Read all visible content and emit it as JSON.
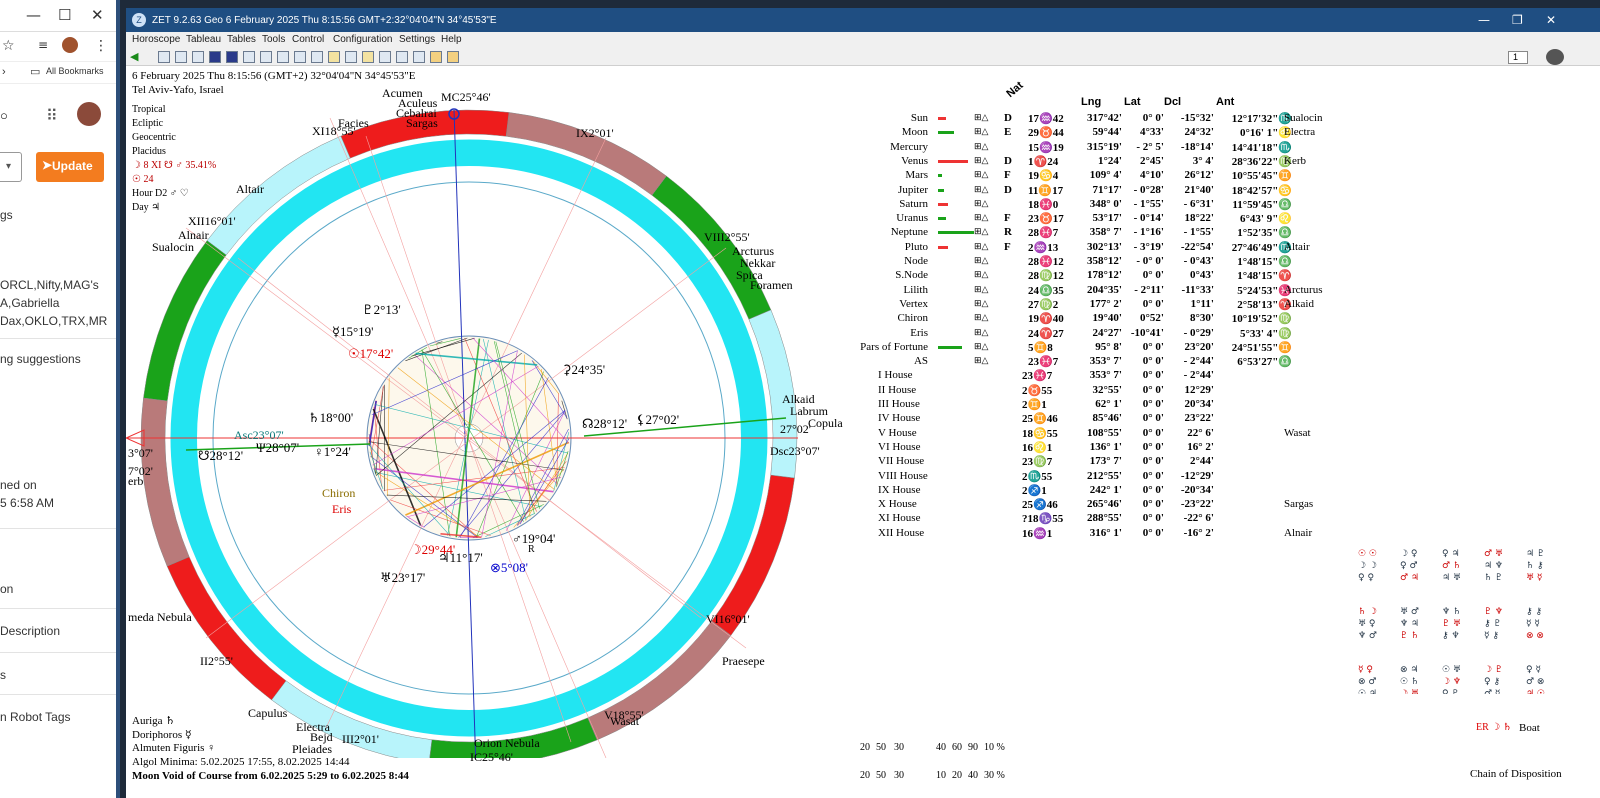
{
  "browser": {
    "bookmarks_label": "All Bookmarks",
    "update_label": "Update",
    "sidebar_texts": [
      "gs",
      "ORCL,Nifty,MAG's",
      "A,Gabriella",
      "Dax,OKLO,TRX,MR",
      "ng suggestions",
      "ned on",
      "5 6:58 AM",
      "on",
      "Description",
      "s",
      "n Robot Tags"
    ]
  },
  "app": {
    "title": "ZET 9.2.63 Geo    6 February 2025  Thu    8:15:56 GMT+2:32°04'04\"N  34°45'53\"E",
    "menu": [
      "Horoscope",
      "Tableau",
      "Tables",
      "Tools",
      "Control",
      "Configuration",
      "Settings",
      "Help"
    ],
    "page_number": "1"
  },
  "chart_header": {
    "line1": "6 February 2025  Thu   8:15:56 (GMT+2) 32°04'04\"N  34°45'53\"E",
    "line2": "Tel Aviv-Yafo, Israel",
    "info": [
      "Tropical",
      "Ecliptic",
      "Geocentric",
      "Placidus",
      "☽  8 XI ☋ ♂ 35.41%",
      "☉  24",
      "Hour D2 ♂ ♡",
      "Day ♃"
    ]
  },
  "wheel_labels": {
    "mc": "MC25°46'",
    "ic": "IC25°46'",
    "asc": "Asc23°07'",
    "dsc": "Dsc23°07'",
    "cusp_ix": "IX2°01'",
    "cusp_viii": "VIII2°55'",
    "cusp_xi": "XI18°55'",
    "cusp_xii": "XII16°01'",
    "cusp_vi": "VI16°01'",
    "cusp_v": "V18°55'",
    "cusp_ii": "II2°55'",
    "cusp_iii": "III2°01'",
    "planets": [
      {
        "t": "♇2°13'",
        "c": "#000"
      },
      {
        "t": "☿15°19'",
        "c": "#000"
      },
      {
        "t": "☉17°42'",
        "c": "#d00"
      },
      {
        "t": "♄18°00'",
        "c": "#000"
      },
      {
        "t": "♅23°17'",
        "c": "#000"
      },
      {
        "t": "♃11°17'",
        "c": "#000"
      },
      {
        "t": "☽29°44'",
        "c": "#d00"
      },
      {
        "t": "♂19°04'",
        "c": "#000"
      },
      {
        "t": "⊗5°08'",
        "c": "#00c"
      },
      {
        "t": "☊28°12'",
        "c": "#000"
      },
      {
        "t": "⚸27°02'",
        "c": "#000"
      },
      {
        "t": "⚳24°35'",
        "c": "#000"
      },
      {
        "t": "Ψ28°07'",
        "c": "#000"
      },
      {
        "t": "♀1°24'",
        "c": "#000"
      },
      {
        "t": "☋28°12'",
        "c": "#000"
      },
      {
        "t": "Chiron",
        "c": "#8a6d00"
      },
      {
        "t": "Eris",
        "c": "#d00"
      },
      {
        "t": "R",
        "c": "#000"
      }
    ],
    "stars": [
      "Acumen",
      "Aculeus",
      "Cebalrai",
      "Sargas",
      "Facies",
      "Altair",
      "Alnair",
      "Sualocin",
      "Arcturus",
      "Nekkar",
      "Spica",
      "Foramen",
      "Alkaid",
      "Labrum",
      "Copula",
      "Praesepe",
      "Wasat",
      "Capulus",
      "Electra",
      "Bejd",
      "Pleiades",
      "Orion Nebula",
      "meda Nebula",
      "erb",
      "3°07'",
      "7°02'",
      "27°02'"
    ]
  },
  "footer": {
    "lines": [
      "Auriga  ♄",
      "Doriphoros  ☿",
      "Almuten Figuris  ♀",
      "Algol Minima: 5.02.2025 17:55,  8.02.2025 14:44",
      "Moon Void of Course from 6.02.2025  5:29 to 6.02.2025  8:44"
    ]
  },
  "table": {
    "headers": {
      "nat": "Nat",
      "lng": "Lng",
      "lat": "Lat",
      "dcl": "Dcl",
      "ant": "Ant"
    },
    "planets": [
      {
        "name": "Sun",
        "state": "D",
        "pos": "17♒42",
        "lng": "317°42'",
        "lat": "0° 0'",
        "dcl": "-15°32'",
        "ant": "12°17'32\"♏",
        "star": "Sualocin"
      },
      {
        "name": "Moon",
        "state": "E",
        "pos": "29♉44",
        "lng": "59°44'",
        "lat": "4°33'",
        "dcl": "24°32'",
        "ant": "0°16' 1\"♌",
        "star": "Electra"
      },
      {
        "name": "Mercury",
        "state": "",
        "pos": "15♒19",
        "lng": "315°19'",
        "lat": "- 2° 5'",
        "dcl": "-18°14'",
        "ant": "14°41'18\"♏",
        "star": ""
      },
      {
        "name": "Venus",
        "state": "D",
        "pos": "1♈24",
        "lng": "1°24'",
        "lat": "2°45'",
        "dcl": "3° 4'",
        "ant": "28°36'22\"♍",
        "star": "Kerb"
      },
      {
        "name": "Mars",
        "state": "F",
        "pos": "19♋4",
        "lng": "109° 4'",
        "lat": "4°10'",
        "dcl": "26°12'",
        "ant": "10°55'45\"♊",
        "star": ""
      },
      {
        "name": "Jupiter",
        "state": "D",
        "pos": "11♊17",
        "lng": "71°17'",
        "lat": "- 0°28'",
        "dcl": "21°40'",
        "ant": "18°42'57\"♋",
        "star": ""
      },
      {
        "name": "Saturn",
        "state": "",
        "pos": "18♓0",
        "lng": "348° 0'",
        "lat": "- 1°55'",
        "dcl": "- 6°31'",
        "ant": "11°59'45\"♎",
        "star": ""
      },
      {
        "name": "Uranus",
        "state": "F",
        "pos": "23♉17",
        "lng": "53°17'",
        "lat": "- 0°14'",
        "dcl": "18°22'",
        "ant": "6°43' 9\"♌",
        "star": ""
      },
      {
        "name": "Neptune",
        "state": "R",
        "pos": "28♓7",
        "lng": "358° 7'",
        "lat": "- 1°16'",
        "dcl": "- 1°55'",
        "ant": "1°52'35\"♎",
        "star": ""
      },
      {
        "name": "Pluto",
        "state": "F",
        "pos": "2♒13",
        "lng": "302°13'",
        "lat": "- 3°19'",
        "dcl": "-22°54'",
        "ant": "27°46'49\"♏",
        "star": "Altair"
      },
      {
        "name": "Node",
        "state": "",
        "pos": "28♓12",
        "lng": "358°12'",
        "lat": "- 0° 0'",
        "dcl": "- 0°43'",
        "ant": "1°48'15\"♎",
        "star": ""
      },
      {
        "name": "S.Node",
        "state": "",
        "pos": "28♍12",
        "lng": "178°12'",
        "lat": "0° 0'",
        "dcl": "0°43'",
        "ant": "1°48'15\"♈",
        "star": ""
      },
      {
        "name": "Lilith",
        "state": "",
        "pos": "24♎35",
        "lng": "204°35'",
        "lat": "- 2°11'",
        "dcl": "-11°33'",
        "ant": "5°24'53\"♓",
        "star": "Arcturus"
      },
      {
        "name": "Vertex",
        "state": "",
        "pos": "27♍2",
        "lng": "177° 2'",
        "lat": "0° 0'",
        "dcl": "1°11'",
        "ant": "2°58'13\"♈",
        "star": "Alkaid"
      },
      {
        "name": "Chiron",
        "state": "",
        "pos": "19♈40",
        "lng": "19°40'",
        "lat": "0°52'",
        "dcl": "8°30'",
        "ant": "10°19'52\"♍",
        "star": ""
      },
      {
        "name": "Eris",
        "state": "",
        "pos": "24♈27",
        "lng": "24°27'",
        "lat": "-10°41'",
        "dcl": "- 0°29'",
        "ant": "5°33' 4\"♍",
        "star": ""
      },
      {
        "name": "Pars of Fortune",
        "state": "",
        "pos": "5♊8",
        "lng": "95° 8'",
        "lat": "0° 0'",
        "dcl": "23°20'",
        "ant": "24°51'55\"♊",
        "star": ""
      },
      {
        "name": "AS",
        "state": "",
        "pos": "23♓7",
        "lng": "353° 7'",
        "lat": "0° 0'",
        "dcl": "- 2°44'",
        "ant": "6°53'27\"♎",
        "star": ""
      }
    ],
    "houses": [
      {
        "name": "I House",
        "pos": "23♓7",
        "lng": "353° 7'",
        "lat": "0° 0'",
        "dcl": "- 2°44'",
        "star": ""
      },
      {
        "name": "II House",
        "pos": "2♉55",
        "lng": "32°55'",
        "lat": "0° 0'",
        "dcl": "12°29'",
        "star": ""
      },
      {
        "name": "III House",
        "pos": "2♊1",
        "lng": "62° 1'",
        "lat": "0° 0'",
        "dcl": "20°34'",
        "star": ""
      },
      {
        "name": "IV House",
        "pos": "25♊46",
        "lng": "85°46'",
        "lat": "0° 0'",
        "dcl": "23°22'",
        "star": ""
      },
      {
        "name": "V House",
        "pos": "18♋55",
        "lng": "108°55'",
        "lat": "0° 0'",
        "dcl": "22° 6'",
        "star": "Wasat"
      },
      {
        "name": "VI House",
        "pos": "16♌1",
        "lng": "136° 1'",
        "lat": "0° 0'",
        "dcl": "16° 2'",
        "star": ""
      },
      {
        "name": "VII House",
        "pos": "23♍7",
        "lng": "173° 7'",
        "lat": "0° 0'",
        "dcl": "2°44'",
        "star": ""
      },
      {
        "name": "VIII House",
        "pos": "2♏55",
        "lng": "212°55'",
        "lat": "0° 0'",
        "dcl": "-12°29'",
        "star": ""
      },
      {
        "name": "IX House",
        "pos": "2♐1",
        "lng": "242° 1'",
        "lat": "0° 0'",
        "dcl": "-20°34'",
        "star": ""
      },
      {
        "name": "X House",
        "pos": "25♐46",
        "lng": "265°46'",
        "lat": "0° 0'",
        "dcl": "-23°22'",
        "star": "Sargas"
      },
      {
        "name": "XI House",
        "pos": "?18♑55",
        "lng": "288°55'",
        "lat": "0° 0'",
        "dcl": "-22° 6'",
        "star": ""
      },
      {
        "name": "XII House",
        "pos": "16♒1",
        "lng": "316° 1'",
        "lat": "0° 0'",
        "dcl": "-16° 2'",
        "star": "Alnair"
      }
    ]
  },
  "stats": {
    "row1": [
      "20",
      "50",
      "30",
      "40",
      "60",
      "90",
      "10 %"
    ],
    "row2": [
      "20",
      "50",
      "30",
      "10",
      "20",
      "40",
      "30 %"
    ]
  },
  "right_panel": {
    "boat": "Boat",
    "chain": "Chain of Disposition",
    "boat_marker": "ER ☽ ♄"
  },
  "colors": {
    "cyan": "#22e5f2",
    "light_cyan": "#b8f4fb",
    "red": "#ee1c1c",
    "green": "#1aa31a",
    "rose": "#b97a7a",
    "title_blue": "#1f4e82",
    "orange": "#f37c1f"
  }
}
